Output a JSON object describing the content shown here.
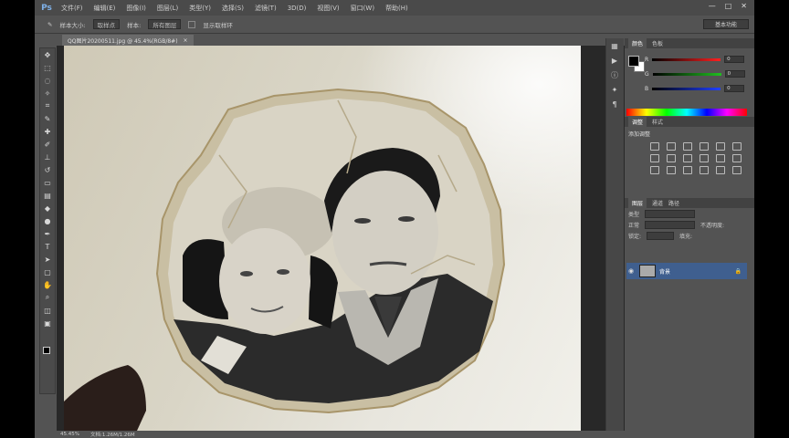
{
  "menubar": {
    "logo": "Ps",
    "items": [
      "文件(F)",
      "编辑(E)",
      "图像(I)",
      "图层(L)",
      "类型(Y)",
      "选择(S)",
      "滤镜(T)",
      "3D(D)",
      "视图(V)",
      "窗口(W)",
      "帮助(H)"
    ]
  },
  "window_controls": [
    "—",
    "□",
    "✕"
  ],
  "options_bar": {
    "size_label": "样本大小:",
    "size_value": "取样点",
    "sample_label": "样本:",
    "sample_value": "所有图层",
    "show_ring": "显示取样环"
  },
  "workspace": "基本功能",
  "document_tab": {
    "title": "QQ图片20200511.jpg @ 45.4%(RGB/8#)",
    "close": "×"
  },
  "status_bar": {
    "zoom": "45.45%",
    "doc": "文档:1.26M/1.26M"
  },
  "panels": {
    "color_tabs": [
      "颜色",
      "色板"
    ],
    "channels": [
      {
        "label": "R",
        "value": "0",
        "color": "#ff2020"
      },
      {
        "label": "G",
        "value": "0",
        "color": "#20c020"
      },
      {
        "label": "B",
        "value": "0",
        "color": "#2040ff"
      }
    ],
    "adjust_tabs": [
      "调整",
      "样式"
    ],
    "adjust_title": "添加调整",
    "layers_tabs": [
      "图层",
      "通道",
      "路径"
    ],
    "layer_kind": "类型",
    "layer_mode": "正常",
    "layer_opacity": "不透明度:",
    "layer_lock": "锁定:",
    "layer_fill": "填充:",
    "layer_name": "背景",
    "layer_lock_icon": "🔒"
  },
  "colors": {
    "accent_selection": "#3f5f8f",
    "ui_dark": "#535353"
  }
}
